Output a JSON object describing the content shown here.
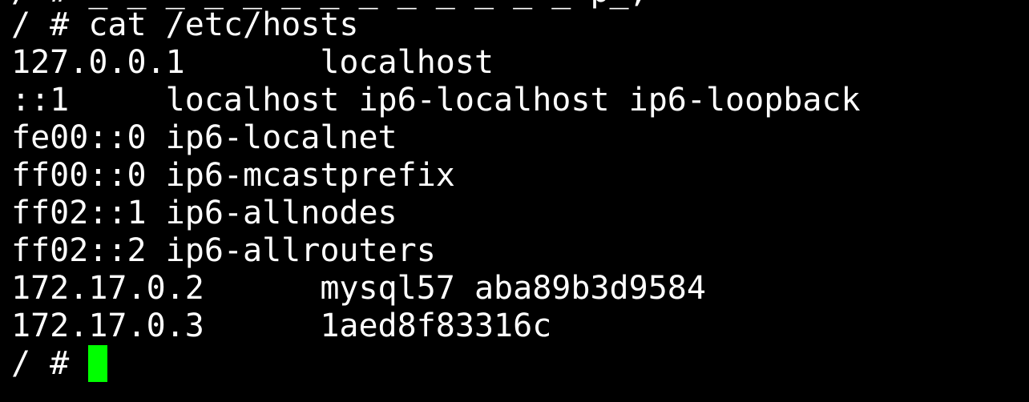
{
  "terminal": {
    "cut_line": "/ # _ _ _ _ _ _ _ _ _ _ _ _ _ p_,",
    "command_line": "/ # cat /etc/hosts",
    "hosts": [
      "127.0.0.1       localhost",
      "::1     localhost ip6-localhost ip6-loopback",
      "fe00::0 ip6-localnet",
      "ff00::0 ip6-mcastprefix",
      "ff02::1 ip6-allnodes",
      "ff02::2 ip6-allrouters",
      "172.17.0.2      mysql57 aba89b3d9584",
      "172.17.0.3      1aed8f83316c"
    ],
    "prompt": "/ # ",
    "cursor_color": "#00ff00",
    "background_color": "#000000",
    "text_color": "#ffffff"
  }
}
